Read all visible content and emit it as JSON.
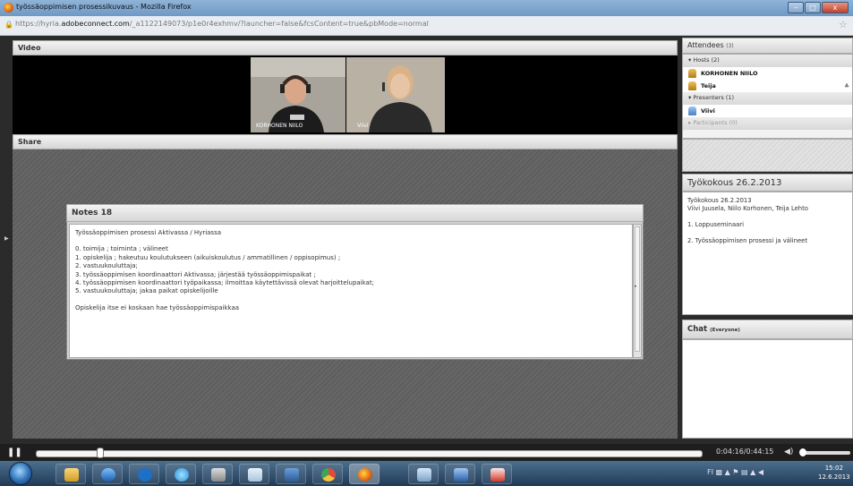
{
  "window": {
    "title": "työssäoppimisen prosessikuvaus - Mozilla Firefox",
    "controls": {
      "minimize": "–",
      "maximize": "□",
      "close": "x"
    }
  },
  "address_bar": {
    "prefix": "https://hyria.",
    "domain": "adobeconnect.com",
    "path": "/_a1122149073/p1e0r4exhmv/?launcher=false&fcsContent=true&pbMode=normal"
  },
  "video_pod": {
    "title": "Video",
    "feeds": [
      {
        "name": "KORHONEN NIILO"
      },
      {
        "name": "Viivi"
      }
    ]
  },
  "share_pod": {
    "title": "Share"
  },
  "notes_pod": {
    "title": "Notes 18",
    "lines": [
      "Työssäoppimisen prosessi Aktivassa / Hyriassa",
      "",
      "0. toimija ; toiminta ; välineet",
      "1.  opiskelija ; hakeutuu koulutukseen (aikuiskoulutus / ammatillinen / oppisopimus) ;",
      "2. vastuukouluttaja;",
      "3. työssäoppimisen koordinaattori Aktivassa; järjestää työssäoppimispaikat ;",
      "4. työssäoppimisen koordinaattori työpaikassa; ilmoittaa käytettävissä olevat harjoittelupaikat;",
      "5. vastuukouluttaja; jakaa paikat opiskelijoille",
      "",
      "Opiskelija itse ei koskaan hae työssäoppimispaikkaa"
    ]
  },
  "attendees": {
    "title": "Attendees",
    "count": "(3)",
    "hosts_label": "Hosts (2)",
    "hosts": [
      "KORHONEN NIILO",
      "Teija"
    ],
    "presenters_label": "Presenters (1)",
    "presenters": [
      "Viivi"
    ],
    "participants_label": "Participants (0)"
  },
  "meeting_notes": {
    "title": "Työkokous 26.2.2013",
    "lines": [
      "Työkokous 26.2.2013",
      "Viivi Juusela, Niilo Korhonen, Teija Lehto",
      "",
      "1. Loppuseminaari",
      "",
      "2. Työssäoppimisen prosessi ja välineet"
    ]
  },
  "chat": {
    "title": "Chat",
    "scope": "(Everyone)"
  },
  "playback": {
    "time": "0:04:16/0:44:15",
    "progress_fraction": 0.097
  },
  "taskbar": {
    "apps": [
      "explorer",
      "media-player",
      "hp",
      "internet-explorer",
      "tools",
      "notepad",
      "save",
      "chrome",
      "firefox",
      "screen",
      "word",
      "acrobat"
    ],
    "tray_text": "FI",
    "clock_time": "15:02",
    "clock_date": "12.6.2013"
  },
  "colors": {
    "titlebar": "#7fa6ce",
    "pod_header": "#e3e3e3",
    "share_bg": "#636363",
    "taskbar": "#2c4a68"
  }
}
